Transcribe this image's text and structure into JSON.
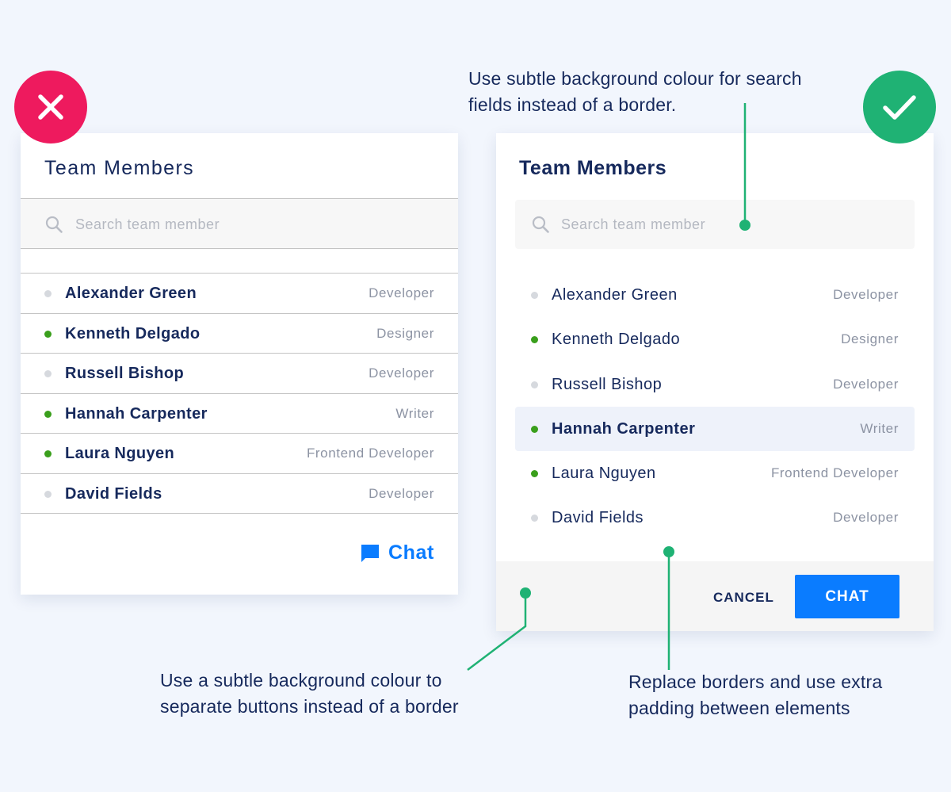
{
  "annotations": {
    "search_tip": [
      "Use subtle background colour for search",
      "fields instead of a border."
    ],
    "buttons_tip": [
      "Use a subtle background colour to",
      "separate buttons instead of a border"
    ],
    "padding_tip": [
      "Replace borders and use extra",
      "padding between elements"
    ]
  },
  "bad_example": {
    "badge_icon": "cross-icon",
    "title": "Team Members",
    "search_placeholder": "Search team member",
    "members": [
      {
        "name": "Alexander Green",
        "role": "Developer",
        "online": false
      },
      {
        "name": "Kenneth Delgado",
        "role": "Designer",
        "online": true
      },
      {
        "name": "Russell Bishop",
        "role": "Developer",
        "online": false
      },
      {
        "name": "Hannah Carpenter",
        "role": "Writer",
        "online": true
      },
      {
        "name": "Laura Nguyen",
        "role": "Frontend Developer",
        "online": true
      },
      {
        "name": "David Fields",
        "role": "Developer",
        "online": false
      }
    ],
    "chat_label": "Chat"
  },
  "good_example": {
    "badge_icon": "check-icon",
    "title": "Team Members",
    "search_placeholder": "Search team member",
    "members": [
      {
        "name": "Alexander Green",
        "role": "Developer",
        "online": false
      },
      {
        "name": "Kenneth Delgado",
        "role": "Designer",
        "online": true
      },
      {
        "name": "Russell Bishop",
        "role": "Developer",
        "online": false
      },
      {
        "name": "Hannah Carpenter",
        "role": "Writer",
        "online": true,
        "highlighted": true
      },
      {
        "name": "Laura Nguyen",
        "role": "Frontend Developer",
        "online": true
      },
      {
        "name": "David Fields",
        "role": "Developer",
        "online": false
      }
    ],
    "cancel_label": "CANCEL",
    "chat_label": "CHAT"
  },
  "colors": {
    "background": "#f2f6fd",
    "text": "#16295c",
    "accent_blue": "#0a7cff",
    "online": "#3a9f1c",
    "offline": "#d6d9de",
    "bad": "#ee1a5e",
    "good": "#1fb274"
  }
}
